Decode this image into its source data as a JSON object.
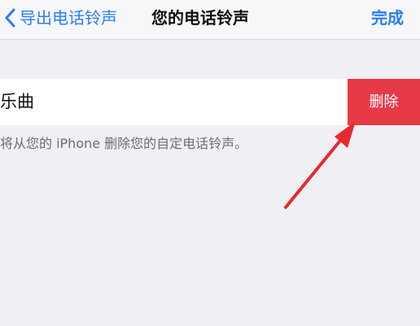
{
  "navbar": {
    "back_label": "导出电话铃声",
    "title": "您的电话铃声",
    "done_label": "完成"
  },
  "ringtone_row": {
    "title": "乐曲",
    "delete_label": "删除"
  },
  "footer_note": "将从您的 iPhone 删除您的自定电话铃声。",
  "colors": {
    "accent_blue": "#2a7cf6",
    "delete_red": "#e63a47",
    "annotation_arrow": "#e8292e",
    "background": "#efeff4"
  }
}
